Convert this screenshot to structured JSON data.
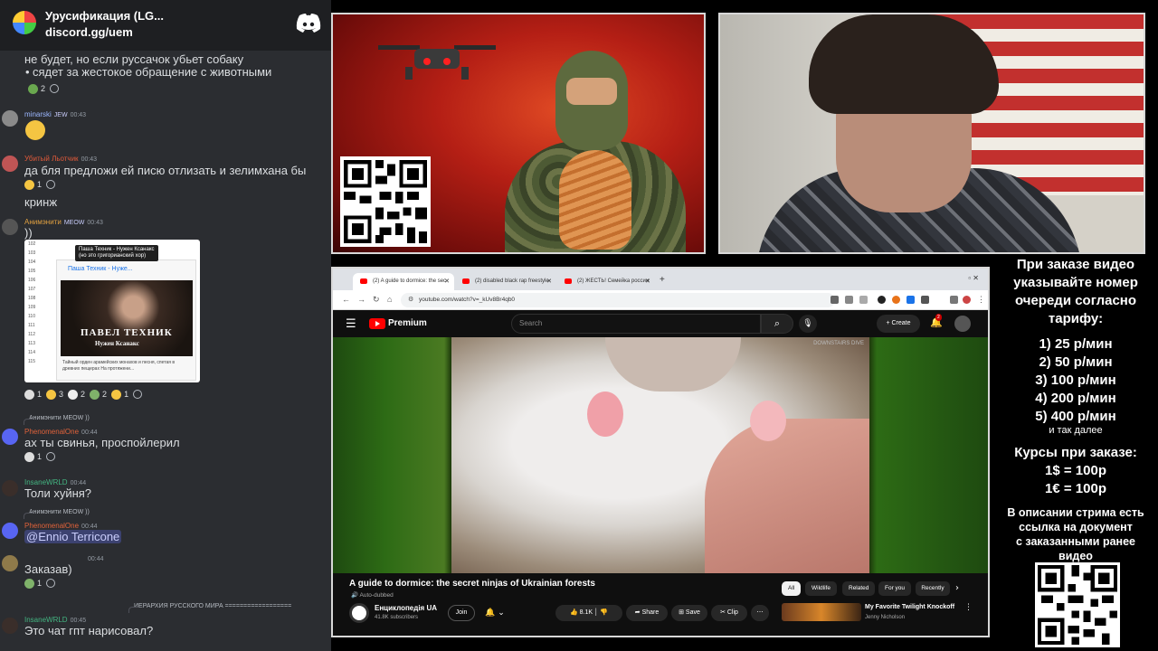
{
  "chat": {
    "server_name": "Урусификация (LG...",
    "server_link": "discord.gg/uem",
    "intro_lines": [
      "не будет, но если руссачок убьет собаку",
      "сядет за жестокое обращение с животными"
    ],
    "intro_reaction_count": "2",
    "messages": [
      {
        "user": "minarski",
        "tag": "JEW",
        "time": "00:43",
        "text": "",
        "reactions": []
      },
      {
        "user": "Убитый Льотчик",
        "tag": "",
        "time": "00:43",
        "text": "да бля предложи ей писю отлизать и зелимхана бы",
        "reactions": [
          "1"
        ]
      },
      {
        "user": "",
        "tag": "",
        "time": "",
        "text": "кринж",
        "reactions": []
      },
      {
        "user": "Анимэнити",
        "tag": "MEOW",
        "time": "00:43",
        "text": "))",
        "reactions": [
          "1",
          "3",
          "2",
          "2",
          "1"
        ]
      },
      {
        "user": "PhenomenalOne",
        "tag": "",
        "time": "00:44",
        "reply": "Анимэнити MEOW ))",
        "text": "ах ты свинья, проспойлерил",
        "reactions": [
          "1"
        ]
      },
      {
        "user": "InsaneWRLD",
        "tag": "",
        "time": "00:44",
        "text": "Толи хуйня?",
        "reactions": []
      },
      {
        "user": "PhenomenalOne",
        "tag": "",
        "time": "00:44",
        "reply": "Анимэнити MEOW ))",
        "text": "@Ennio Terricone",
        "reactions": []
      },
      {
        "user": "",
        "tag": "",
        "time": "00:44",
        "text": "Заказав)",
        "reactions": [
          "1"
        ]
      },
      {
        "user": "InsaneWRLD",
        "tag": "",
        "time": "00:45",
        "reply": "ИЕРАРХИЯ РУССКОГО МИРА ==================",
        "text": "Это чат гпт нарисовал?",
        "reactions": []
      }
    ],
    "embed": {
      "tooltip_line1": "Паша Техник - Нужен Ксанакс",
      "tooltip_line2": "(но это григорианский хор)",
      "card_title": "Паша Техник - Нуже...",
      "thumb_title": "ПАВЕЛ ТЕХНИК",
      "thumb_subtitle": "Нужен Ксанакс",
      "description": "Тайный орден арамейских монахов и песня, спетая в древних пещерах На протяжени...",
      "row_numbers": [
        "102",
        "103",
        "104",
        "105",
        "106",
        "107",
        "108",
        "109",
        "110",
        "111",
        "112",
        "113",
        "114",
        "115"
      ]
    }
  },
  "browser": {
    "tabs": [
      {
        "label": "(2) A guide to dormice: the sec"
      },
      {
        "label": "(2) disabled black rap freestyle"
      },
      {
        "label": "(2) ЖЕСТЬ! Семейка россии"
      }
    ],
    "url": "youtube.com/watch?v=_kUv8Br4qb0",
    "youtube": {
      "brand": "Premium",
      "search_placeholder": "Search",
      "create_label": "+ Create",
      "notif_count": "2",
      "watermark": "DOWNSTAIRS DIVE",
      "video_title": "A guide to dormice: the secret ninjas of Ukrainian forests",
      "auto_dubbed": "Auto-dubbed",
      "channel_name": "Енциклопедія UA",
      "subscribers": "41.8K subscribers",
      "join_label": "Join",
      "like_count": "8.1K",
      "share_label": "Share",
      "save_label": "Save",
      "clip_label": "Clip",
      "chips": [
        "All",
        "Wildlife",
        "Related",
        "For you",
        "Recently"
      ],
      "rec_title": "My Favorite Twilight Knockoff",
      "rec_author": "Jenny Nicholson"
    }
  },
  "panel": {
    "lines": [
      "При заказе видео",
      "указывайте номер",
      "очереди согласно",
      "тарифу:"
    ],
    "prices": [
      "1) 25 р/мин",
      "2) 50 р/мин",
      "3) 100 р/мин",
      "4) 200 р/мин",
      "5) 400 р/мин"
    ],
    "and_so_on": "и так далее",
    "rates_title": "Курсы при заказе:",
    "rates": [
      "1$ = 100р",
      "1€ = 100р"
    ],
    "footer": [
      "В описании стрима есть",
      "ссылка на документ",
      "с заказанными ранее",
      "видео"
    ]
  },
  "colors": {
    "discord_bg": "#2b2d31",
    "youtube_red": "#ff0000",
    "poster_red": "#b51f15"
  }
}
